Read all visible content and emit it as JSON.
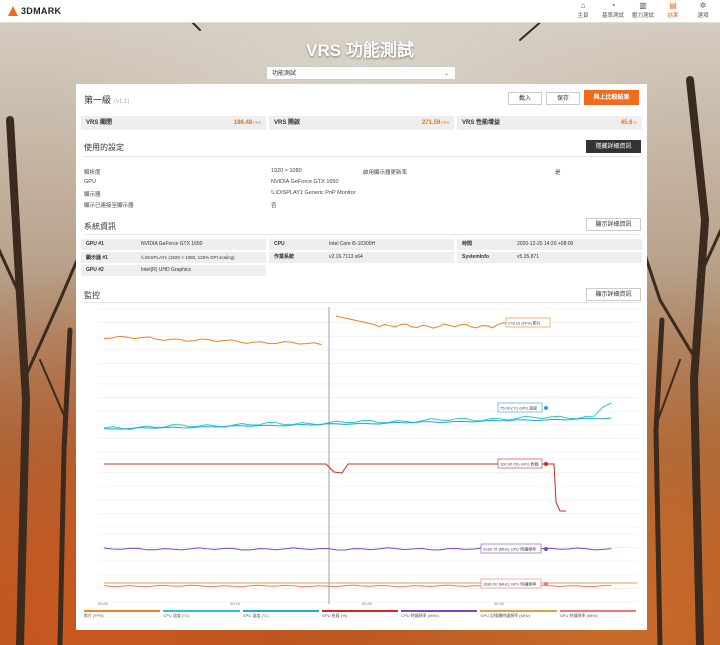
{
  "app": {
    "logo": "3DMARK"
  },
  "nav": [
    {
      "label": "主頁",
      "icon": "home-icon",
      "glyph": "⌂"
    },
    {
      "label": "基準測試",
      "icon": "benchmark-icon",
      "glyph": "◔"
    },
    {
      "label": "壓力測試",
      "icon": "stress-icon",
      "glyph": "▥"
    },
    {
      "label": "結果",
      "icon": "results-icon",
      "glyph": "▤",
      "active": true
    },
    {
      "label": "選項",
      "icon": "gear-icon",
      "glyph": "✲"
    }
  ],
  "page_title": "VRS 功能測試",
  "test_select": {
    "value": "功能測試"
  },
  "result": {
    "heading": "第一級",
    "version": "(v1.1)",
    "buttons": {
      "load": "載入",
      "save": "保存",
      "compare": "與上比較結果"
    },
    "scores": [
      {
        "label": "VRS 關閉",
        "value": "186.48",
        "unit": "FPS"
      },
      {
        "label": "VRS 開啟",
        "value": "271.59",
        "unit": "FPS"
      },
      {
        "label": "VRS 性能增益",
        "value": "45.6",
        "unit": "%"
      }
    ]
  },
  "settings": {
    "title": "使用的設定",
    "button": "隱藏詳細資訊",
    "rows": [
      {
        "k": "解析度",
        "v": "1920 × 1080"
      },
      {
        "k": "GPU",
        "v": "NVIDIA GeForce GTX 1650"
      },
      {
        "k": "顯示器",
        "v": "\\\\.\\DISPLAY1 Generic PnP Monitor"
      },
      {
        "k": "顯示已連接至顯示器",
        "v": "否"
      }
    ],
    "extra": {
      "k": "啟用顯示器更新率",
      "v": "是"
    }
  },
  "sysinfo": {
    "title": "系統資訊",
    "button": "顯示詳細資訊",
    "items": [
      {
        "k": "GPU #1",
        "v": "NVIDIA GeForce GTX 1650"
      },
      {
        "k": "CPU",
        "v": "Intel Core i5-10300H"
      },
      {
        "k": "時間",
        "v": "2020-12-20 14:20 +08:00"
      },
      {
        "k": "顯示器 #1",
        "v": "\\\\.\\DISPLAY1 (1920 × 1080, 125% DPI scaling)"
      },
      {
        "k": "作業系統",
        "v": "v2.16.7113 s64"
      },
      {
        "k": "SystemInfo",
        "v": "v5.35.871"
      },
      {
        "k": "GPU #2",
        "v": "Intel(R) UHD Graphics"
      }
    ]
  },
  "monitor": {
    "title": "監控",
    "button": "顯示詳細資訊",
    "tooltips": {
      "fps": "278.16 (FPS) 影片",
      "temp": "75.00 (°C) GPU 溫度",
      "load": "100.00 (%) GPU 負載",
      "cpu_clock": "4189.75 (MHz) CPU 時鐘頻率",
      "gpu_clock": "1680.00 (MHz) GPU 時鐘頻率"
    },
    "x_ticks": [
      "00:00",
      "00:10",
      "00:20",
      "00:30"
    ],
    "legend": [
      {
        "label": "影片 (FPS)",
        "color": "#f07f1e"
      },
      {
        "label": "CPU 溫度 (°C)",
        "color": "#26c9c9"
      },
      {
        "label": "GPU 溫度 (°C)",
        "color": "#1ea7e0"
      },
      {
        "label": "GPU 負載 (%)",
        "color": "#d0281f"
      },
      {
        "label": "CPU 時鐘頻率 (MHz)",
        "color": "#7e44c5"
      },
      {
        "label": "GPU 記憶體時鐘頻率 (MHz)",
        "color": "#e0a040"
      },
      {
        "label": "GPU 時鐘頻率 (MHz)",
        "color": "#ee7777"
      }
    ]
  }
}
